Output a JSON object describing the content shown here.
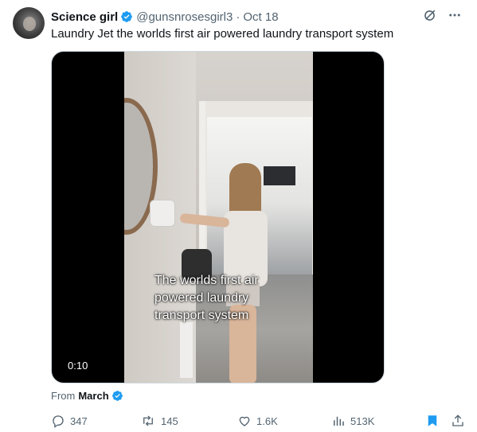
{
  "author": {
    "name": "Science girl",
    "handle": "@gunsnrosesgirl3",
    "separator": "·",
    "date": "Oct 18"
  },
  "tweet": {
    "text": "Laundry Jet the worlds first air powered laundry transport system"
  },
  "media": {
    "caption_lines": [
      "The worlds first air",
      "powered laundry",
      "transport system"
    ],
    "timestamp": "0:10"
  },
  "source": {
    "prefix": "From",
    "name": "March"
  },
  "actions": {
    "replies": "347",
    "reposts": "145",
    "likes": "1.6K",
    "views": "513K"
  },
  "icons": {
    "verified": "verified-badge-icon",
    "grok": "grok-icon",
    "more": "more-icon",
    "reply": "reply-icon",
    "repost": "repost-icon",
    "like": "like-icon",
    "views": "views-icon",
    "bookmark": "bookmark-icon",
    "share": "share-icon"
  },
  "colors": {
    "accent": "#1d9bf0",
    "text": "#0f1419",
    "muted": "#536471"
  }
}
